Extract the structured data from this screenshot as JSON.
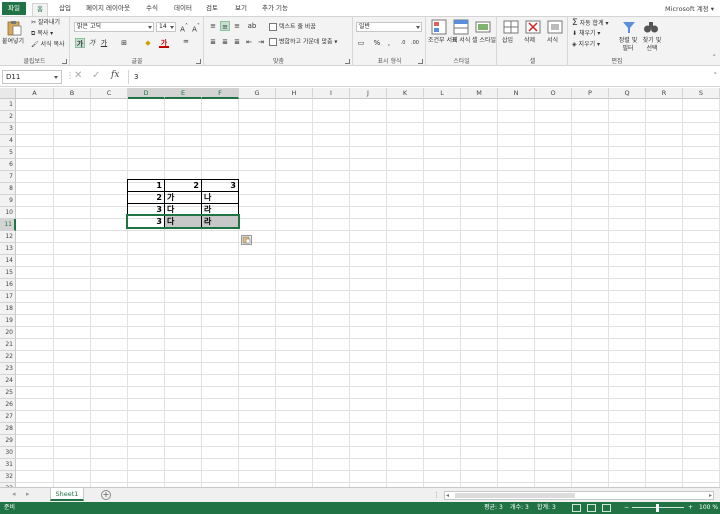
{
  "ribbon_tabs": [
    "파일",
    "홈",
    "삽입",
    "페이지 레이아웃",
    "수식",
    "데이터",
    "검토",
    "보기",
    "추가 기능"
  ],
  "user_label": "Microsoft 계정",
  "clipboard": {
    "paste": "붙여넣기",
    "cut": "잘라내기",
    "copy": "복사",
    "format_painter": "서식 복사",
    "label": "클립보드"
  },
  "font": {
    "name": "맑은 고딕",
    "size": "14",
    "bold": "가",
    "italic": "가",
    "underline": "가",
    "label": "글꼴"
  },
  "alignment": {
    "wrap": "텍스트 줄 바꿈",
    "merge": "병합하고 가운데 맞춤",
    "label": "맞춤"
  },
  "number": {
    "format": "일반",
    "percent": "%",
    "comma": ",",
    "label": "표시 형식"
  },
  "styles": {
    "conditional": "조건부 서식",
    "table": "표 서식",
    "cell": "셀 스타일",
    "label": "스타일"
  },
  "cells": {
    "insert": "삽입",
    "delete": "삭제",
    "format": "서식",
    "label": "셀"
  },
  "editing": {
    "autosum": "자동 합계",
    "fill": "채우기",
    "clear": "지우기",
    "sort": "정렬 및 필터",
    "find": "찾기 및 선택",
    "label": "편집"
  },
  "formula_bar": {
    "name_box": "D11",
    "fx": "fx",
    "value": "3"
  },
  "columns": [
    "A",
    "B",
    "C",
    "D",
    "E",
    "F",
    "G",
    "H",
    "I",
    "J",
    "K",
    "L",
    "M",
    "N",
    "O",
    "P",
    "Q",
    "R",
    "S"
  ],
  "rows": [
    "1",
    "2",
    "3",
    "4",
    "5",
    "6",
    "7",
    "8",
    "9",
    "10",
    "11",
    "12",
    "13",
    "14",
    "15",
    "16",
    "17",
    "18",
    "19",
    "20",
    "21",
    "22",
    "23",
    "24",
    "25",
    "26",
    "27",
    "28",
    "29",
    "30",
    "31",
    "32",
    "33"
  ],
  "sheet_cells": {
    "D8": "1",
    "E8": "2",
    "F8": "3",
    "D9": "2",
    "E9": "가",
    "F9": "나",
    "D10": "3",
    "E10": "다",
    "F10": "라",
    "D11": "3",
    "E11": "다",
    "F11": "라"
  },
  "sheet_tab": "Sheet1",
  "status": {
    "ready": "준비",
    "average": "평균: 3",
    "count": "개수: 3",
    "sum": "합계: 3",
    "zoom": "100 %"
  }
}
